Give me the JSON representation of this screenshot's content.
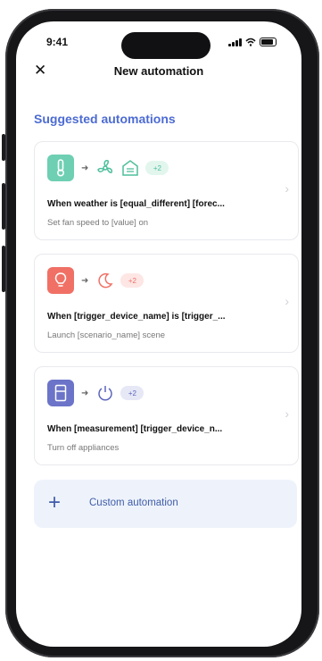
{
  "status_bar": {
    "time": "9:41"
  },
  "header": {
    "title": "New automation",
    "close_symbol": "✕"
  },
  "section_title": "Suggested automations",
  "cards": [
    {
      "trigger_icon": "thermometer-icon",
      "trigger_color": "#6ecfb2",
      "action_icons": [
        "fan-icon",
        "garage-icon"
      ],
      "more_label": "+2",
      "title": "When weather is [equal_different] [forec...",
      "subtitle": "Set fan speed to [value] on"
    },
    {
      "trigger_icon": "lightbulb-icon",
      "trigger_color": "#f07065",
      "action_icons": [
        "moon-icon"
      ],
      "more_label": "+2",
      "title": "When [trigger_device_name] is [trigger_...",
      "subtitle": "Launch [scenario_name] scene"
    },
    {
      "trigger_icon": "fridge-icon",
      "trigger_color": "#6b74c8",
      "action_icons": [
        "power-icon"
      ],
      "more_label": "+2",
      "title": "When [measurement] [trigger_device_n...",
      "subtitle": "Turn off appliances"
    }
  ],
  "custom": {
    "label": "Custom automation",
    "plus": "+"
  },
  "colors": {
    "accent": "#4c6bd3",
    "custom_bg": "#eef3fb"
  }
}
